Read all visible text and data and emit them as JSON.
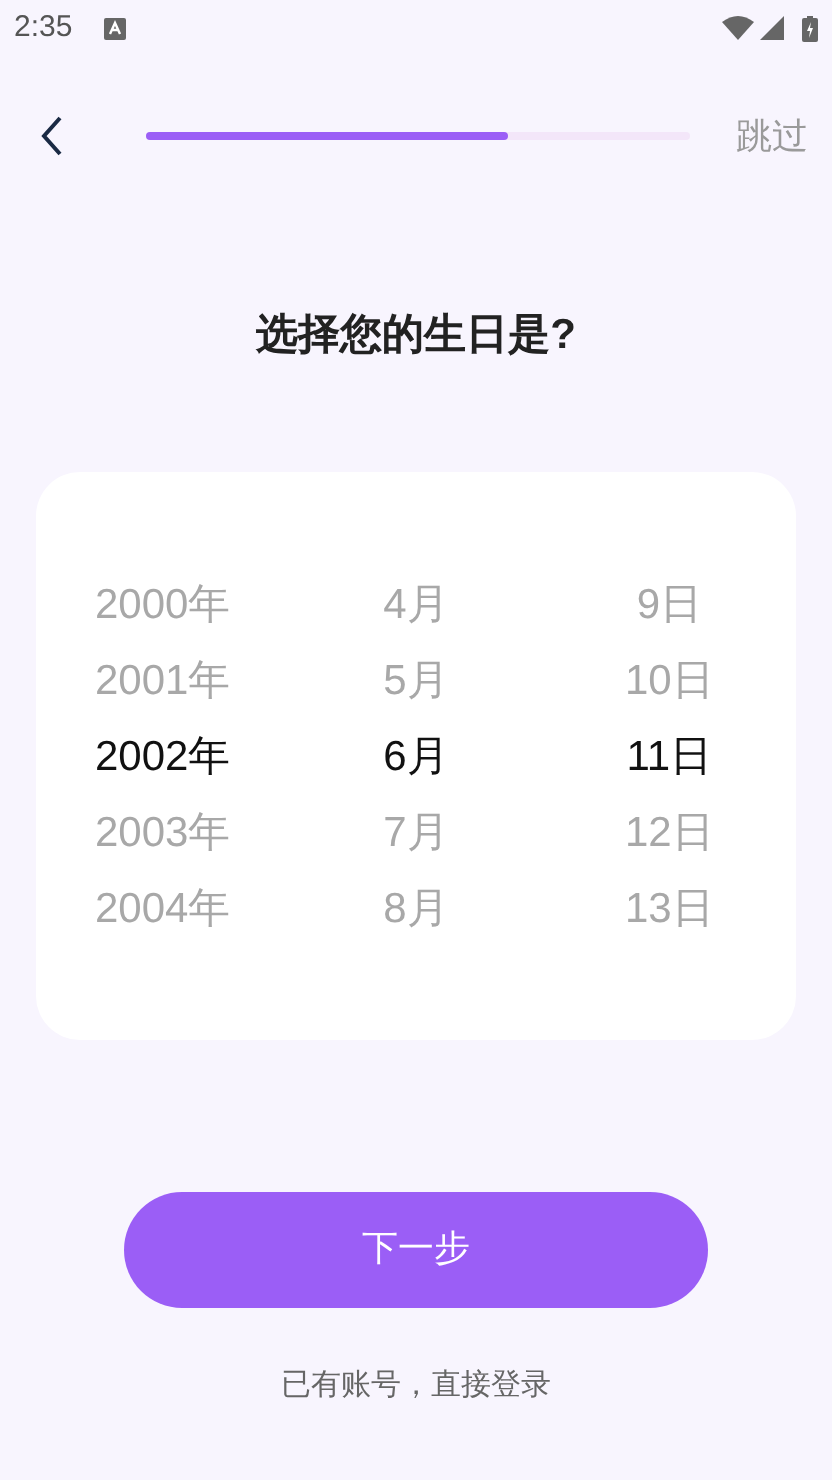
{
  "status_bar": {
    "time": "2:35"
  },
  "header": {
    "skip": "跳过",
    "progress": {
      "level": 0.665
    }
  },
  "title": "选择您的生日是?",
  "picker": {
    "columns": [
      {
        "items": [
          {
            "text": "2000年",
            "selected": false
          },
          {
            "text": "2001年",
            "selected": false
          },
          {
            "text": "2002年",
            "selected": true
          },
          {
            "text": "2003年",
            "selected": false
          },
          {
            "text": "2004年",
            "selected": false
          }
        ]
      },
      {
        "items": [
          {
            "text": "4月",
            "selected": false
          },
          {
            "text": "5月",
            "selected": false
          },
          {
            "text": "6月",
            "selected": true
          },
          {
            "text": "7月",
            "selected": false
          },
          {
            "text": "8月",
            "selected": false
          }
        ]
      },
      {
        "items": [
          {
            "text": "9日",
            "selected": false
          },
          {
            "text": "10日",
            "selected": false
          },
          {
            "text": "11日",
            "selected": true
          },
          {
            "text": "12日",
            "selected": false
          },
          {
            "text": "13日",
            "selected": false
          }
        ]
      }
    ]
  },
  "next_button": "下一步",
  "login_link": "已有账号，直接登录"
}
